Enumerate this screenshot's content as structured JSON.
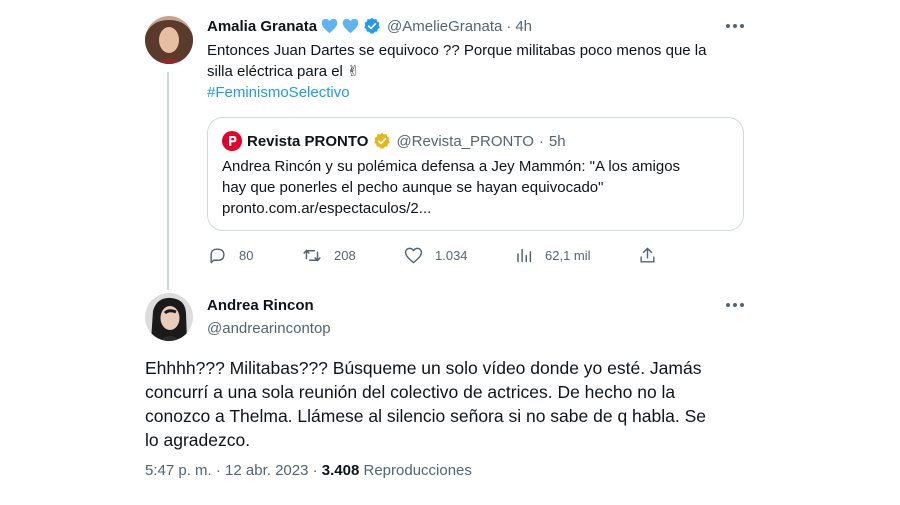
{
  "tweet1": {
    "author_name": "Amalia Granata",
    "author_handle": "@AmelieGranata",
    "time_ago": "4h",
    "text_line1": "Entonces Juan Dartes se equivoco ?? Porque militabas poco menos que la",
    "text_line2": "silla eléctrica para el ✌",
    "hashtag": "#FeminismoSelectivo",
    "quote": {
      "author_name": "Revista PRONTO",
      "author_handle": "@Revista_PRONTO",
      "time_ago": "5h",
      "text_line1": "Andrea Rincón y su polémica defensa a Jey Mammón: \"A los amigos",
      "text_line2": "hay que ponerles el pecho aunque se hayan equivocado\"",
      "link": "pronto.com.ar/espectaculos/2..."
    },
    "actions": {
      "replies": "80",
      "retweets": "208",
      "likes": "1.034",
      "views": "62,1 mil"
    }
  },
  "tweet2": {
    "author_name": "Andrea Rincon",
    "author_handle": "@andrearincontop",
    "text_line1": "Ehhhh??? Militabas??? Búsqueme un solo vídeo donde yo esté. Jamás",
    "text_line2": "concurrí a una sola reunión del colectivo de actrices. De hecho no la",
    "text_line3": "conozco a Thelma. Llámese al silencio señora si no sabe de q habla. Se",
    "text_line4": "lo agradezco.",
    "timestamp": "5:47 p. m. · 12 abr. 2023 · ",
    "views_count": "3.408",
    "views_label": "Reproducciones"
  },
  "colors": {
    "accent": "#1d9bf0",
    "verified_gold": "#e2b719",
    "pronto_red": "#e4002b",
    "muted": "#536471"
  }
}
